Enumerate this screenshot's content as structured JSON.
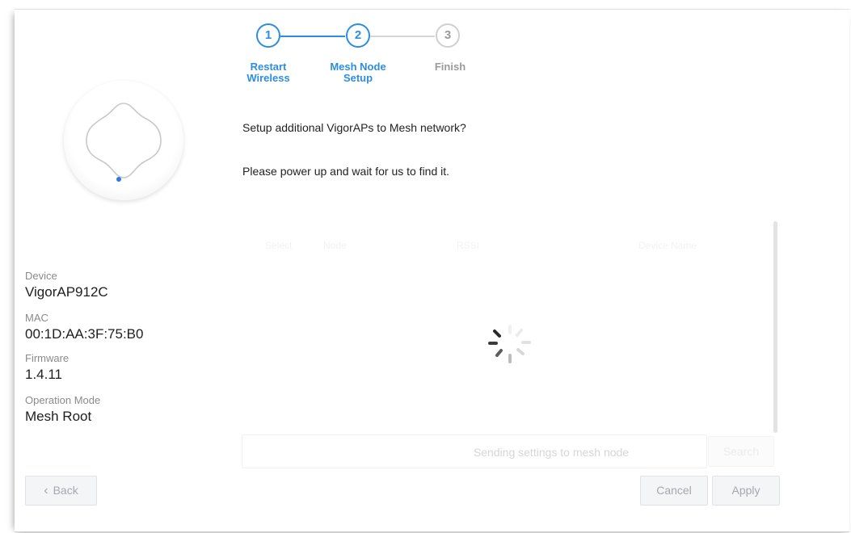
{
  "stepper": {
    "steps": [
      {
        "number": "1",
        "label_line1": "Restart",
        "label_line2": "Wireless"
      },
      {
        "number": "2",
        "label_line1": "Mesh Node",
        "label_line2": "Setup"
      },
      {
        "number": "3",
        "label_line1": "Finish",
        "label_line2": ""
      }
    ],
    "active_color": "#2d8ee0",
    "inactive_color": "#9a9a9a"
  },
  "device": {
    "image": "ceiling-access-point-icon",
    "fields": [
      {
        "label": "Device",
        "value": "VigorAP912C"
      },
      {
        "label": "MAC",
        "value": "00:1D:AA:3F:75:B0"
      },
      {
        "label": "Firmware",
        "value": "1.4.11"
      },
      {
        "label": "Operation Mode",
        "value": "Mesh Root"
      }
    ]
  },
  "messages": {
    "question": "Setup additional VigorAPs to Mesh network?",
    "instruction": "Please power up and wait for us to find it."
  },
  "mesh_table": {
    "columns": [
      "Select",
      "Node",
      "RSSI",
      "Device Name"
    ],
    "loading_icon": "spinner-icon"
  },
  "status_bar": {
    "text": "Sending settings to mesh node",
    "search_label": "Search"
  },
  "footer": {
    "back_label": "Back",
    "cancel_label": "Cancel",
    "apply_label": "Apply"
  }
}
